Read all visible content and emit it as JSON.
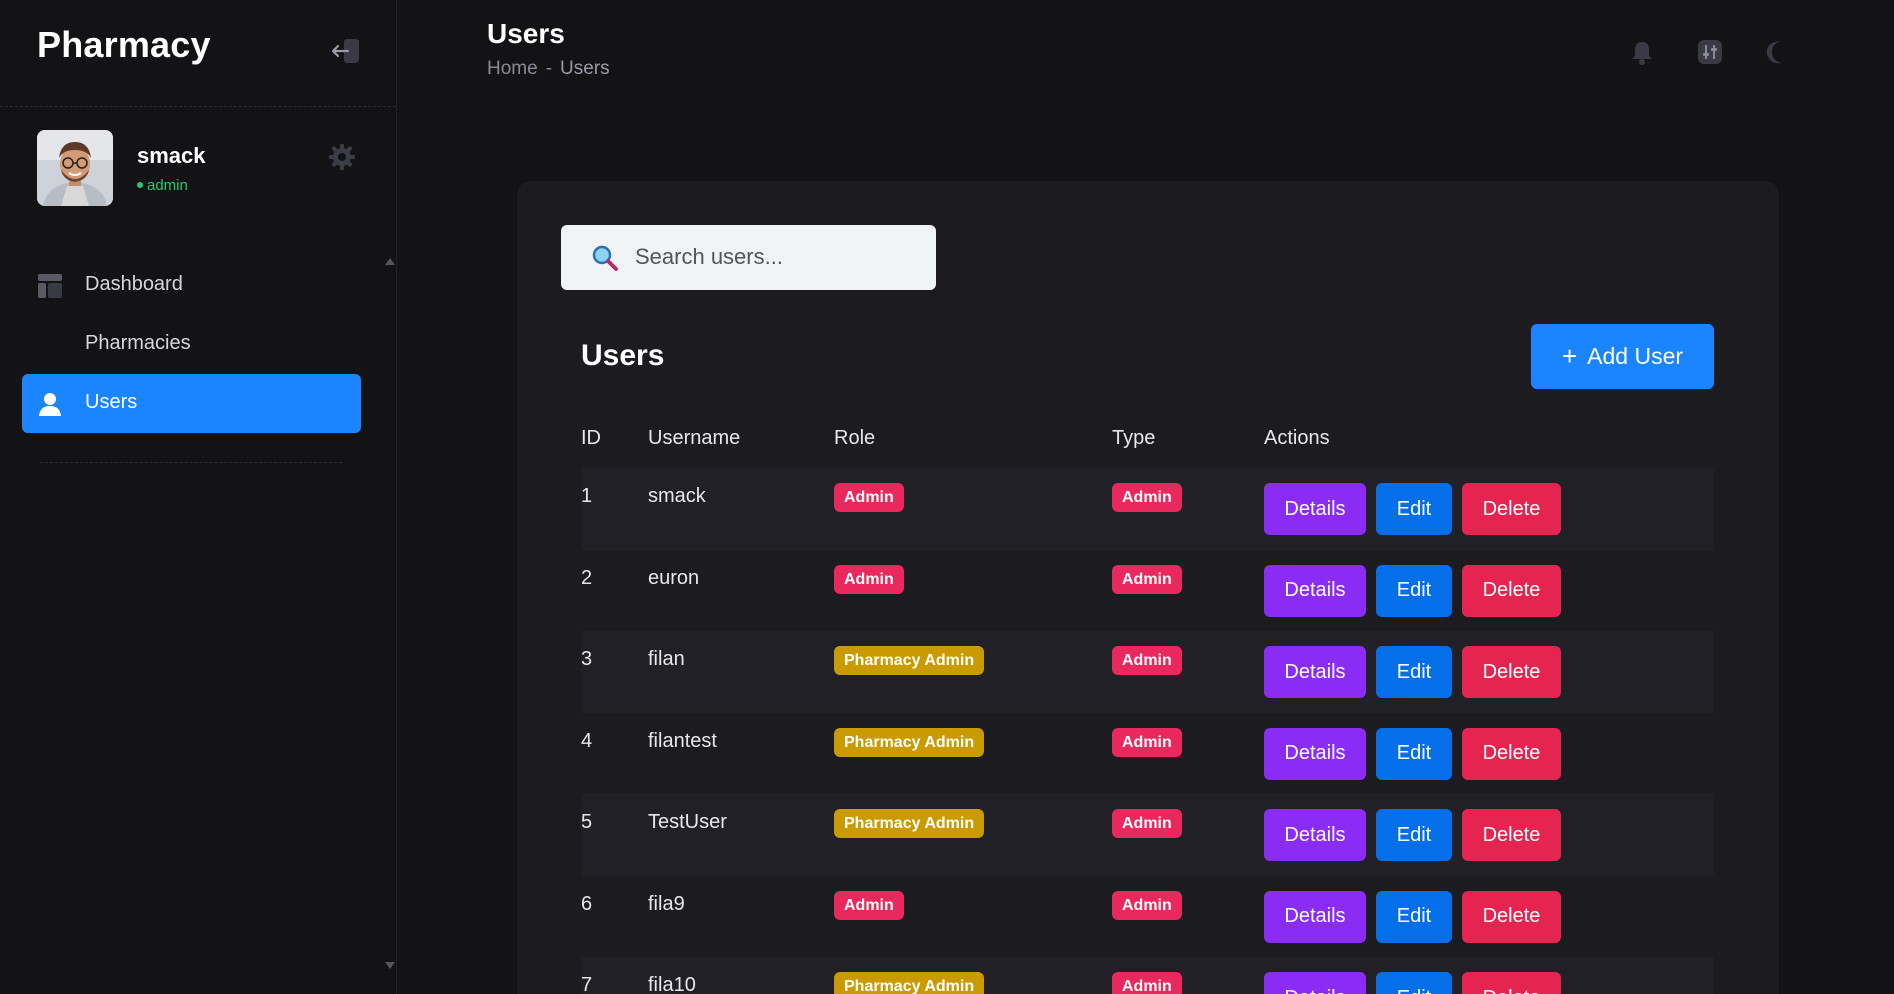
{
  "app": {
    "brand": "Pharmacy"
  },
  "user": {
    "name": "smack",
    "role": "admin"
  },
  "sidebar": {
    "items": [
      {
        "label": "Dashboard",
        "icon": "dashboard-icon",
        "active": false
      },
      {
        "label": "Pharmacies",
        "icon": "",
        "active": false
      },
      {
        "label": "Users",
        "icon": "user-icon",
        "active": true
      }
    ]
  },
  "header": {
    "title": "Users",
    "breadcrumb": {
      "home": "Home",
      "separator": "-",
      "current": "Users"
    },
    "icons": [
      "bell-icon",
      "sliders-icon",
      "moon-icon"
    ]
  },
  "search": {
    "placeholder": "Search users...",
    "value": ""
  },
  "card": {
    "title": "Users",
    "add_button": {
      "plus": "+",
      "label": "Add User"
    }
  },
  "table": {
    "columns": [
      "ID",
      "Username",
      "Role",
      "Type",
      "Actions"
    ],
    "rows": [
      {
        "id": "1",
        "username": "smack",
        "role": "Admin",
        "type": "Admin"
      },
      {
        "id": "2",
        "username": "euron",
        "role": "Admin",
        "type": "Admin"
      },
      {
        "id": "3",
        "username": "filan",
        "role": "Pharmacy Admin",
        "type": "Admin"
      },
      {
        "id": "4",
        "username": "filantest",
        "role": "Pharmacy Admin",
        "type": "Admin"
      },
      {
        "id": "5",
        "username": "TestUser",
        "role": "Pharmacy Admin",
        "type": "Admin"
      },
      {
        "id": "6",
        "username": "fila9",
        "role": "Admin",
        "type": "Admin"
      },
      {
        "id": "7",
        "username": "fila10",
        "role": "Pharmacy Admin",
        "type": "Admin"
      }
    ],
    "actions": {
      "details": "Details",
      "edit": "Edit",
      "delete": "Delete"
    }
  },
  "colors": {
    "accent": "#1b84ff",
    "admin_badge": "#e9285e",
    "pharmacy_admin_badge": "#c99b00",
    "details": "#8b2cf5",
    "edit": "#056ee9",
    "delete": "#e5244f",
    "online": "#28c76f"
  }
}
